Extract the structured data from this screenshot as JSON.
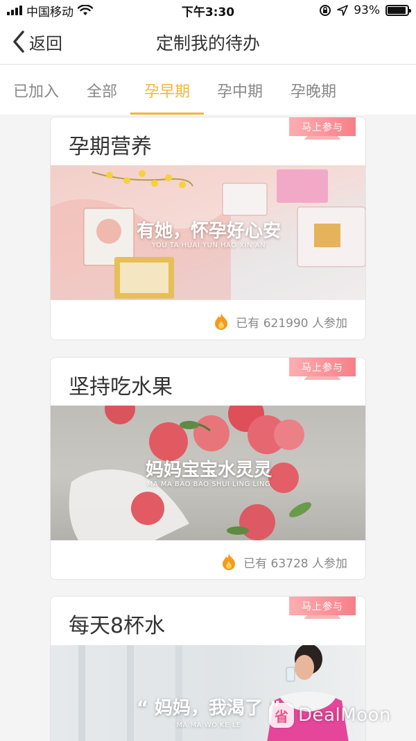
{
  "status_bar": {
    "carrier": "中国移动",
    "time": "下午3:30",
    "battery": "93%",
    "battery_level": 0.93
  },
  "nav": {
    "back_label": "返回",
    "title": "定制我的待办"
  },
  "tabs": [
    {
      "label": "已加入",
      "active": false
    },
    {
      "label": "全部",
      "active": false
    },
    {
      "label": "孕早期",
      "active": true
    },
    {
      "label": "孕中期",
      "active": false
    },
    {
      "label": "孕晚期",
      "active": false
    }
  ],
  "colors": {
    "accent": "#f0b838",
    "badge": "#f87f87"
  },
  "cards": [
    {
      "title": "孕期营养",
      "badge": "马上参与",
      "image_title": "有她，怀孕好心安",
      "image_subtitle": "YOU TA HUAI YUN HAO XIN AN",
      "participants": "已有 621990 人参加",
      "icon": "fire-icon"
    },
    {
      "title": "坚持吃水果",
      "badge": "马上参与",
      "image_title": "妈妈宝宝水灵灵",
      "image_subtitle": "MA MA BAO BAO SHUI LING LING",
      "participants": "已有 63728 人参加",
      "icon": "fire-icon"
    },
    {
      "title": "每天8杯水",
      "badge": "马上参与",
      "image_title": "“ 妈妈，我渴了 ”",
      "image_subtitle": "MA MA WO KE LE"
    }
  ],
  "watermark": {
    "logo": "省",
    "text": "DealMoon"
  }
}
